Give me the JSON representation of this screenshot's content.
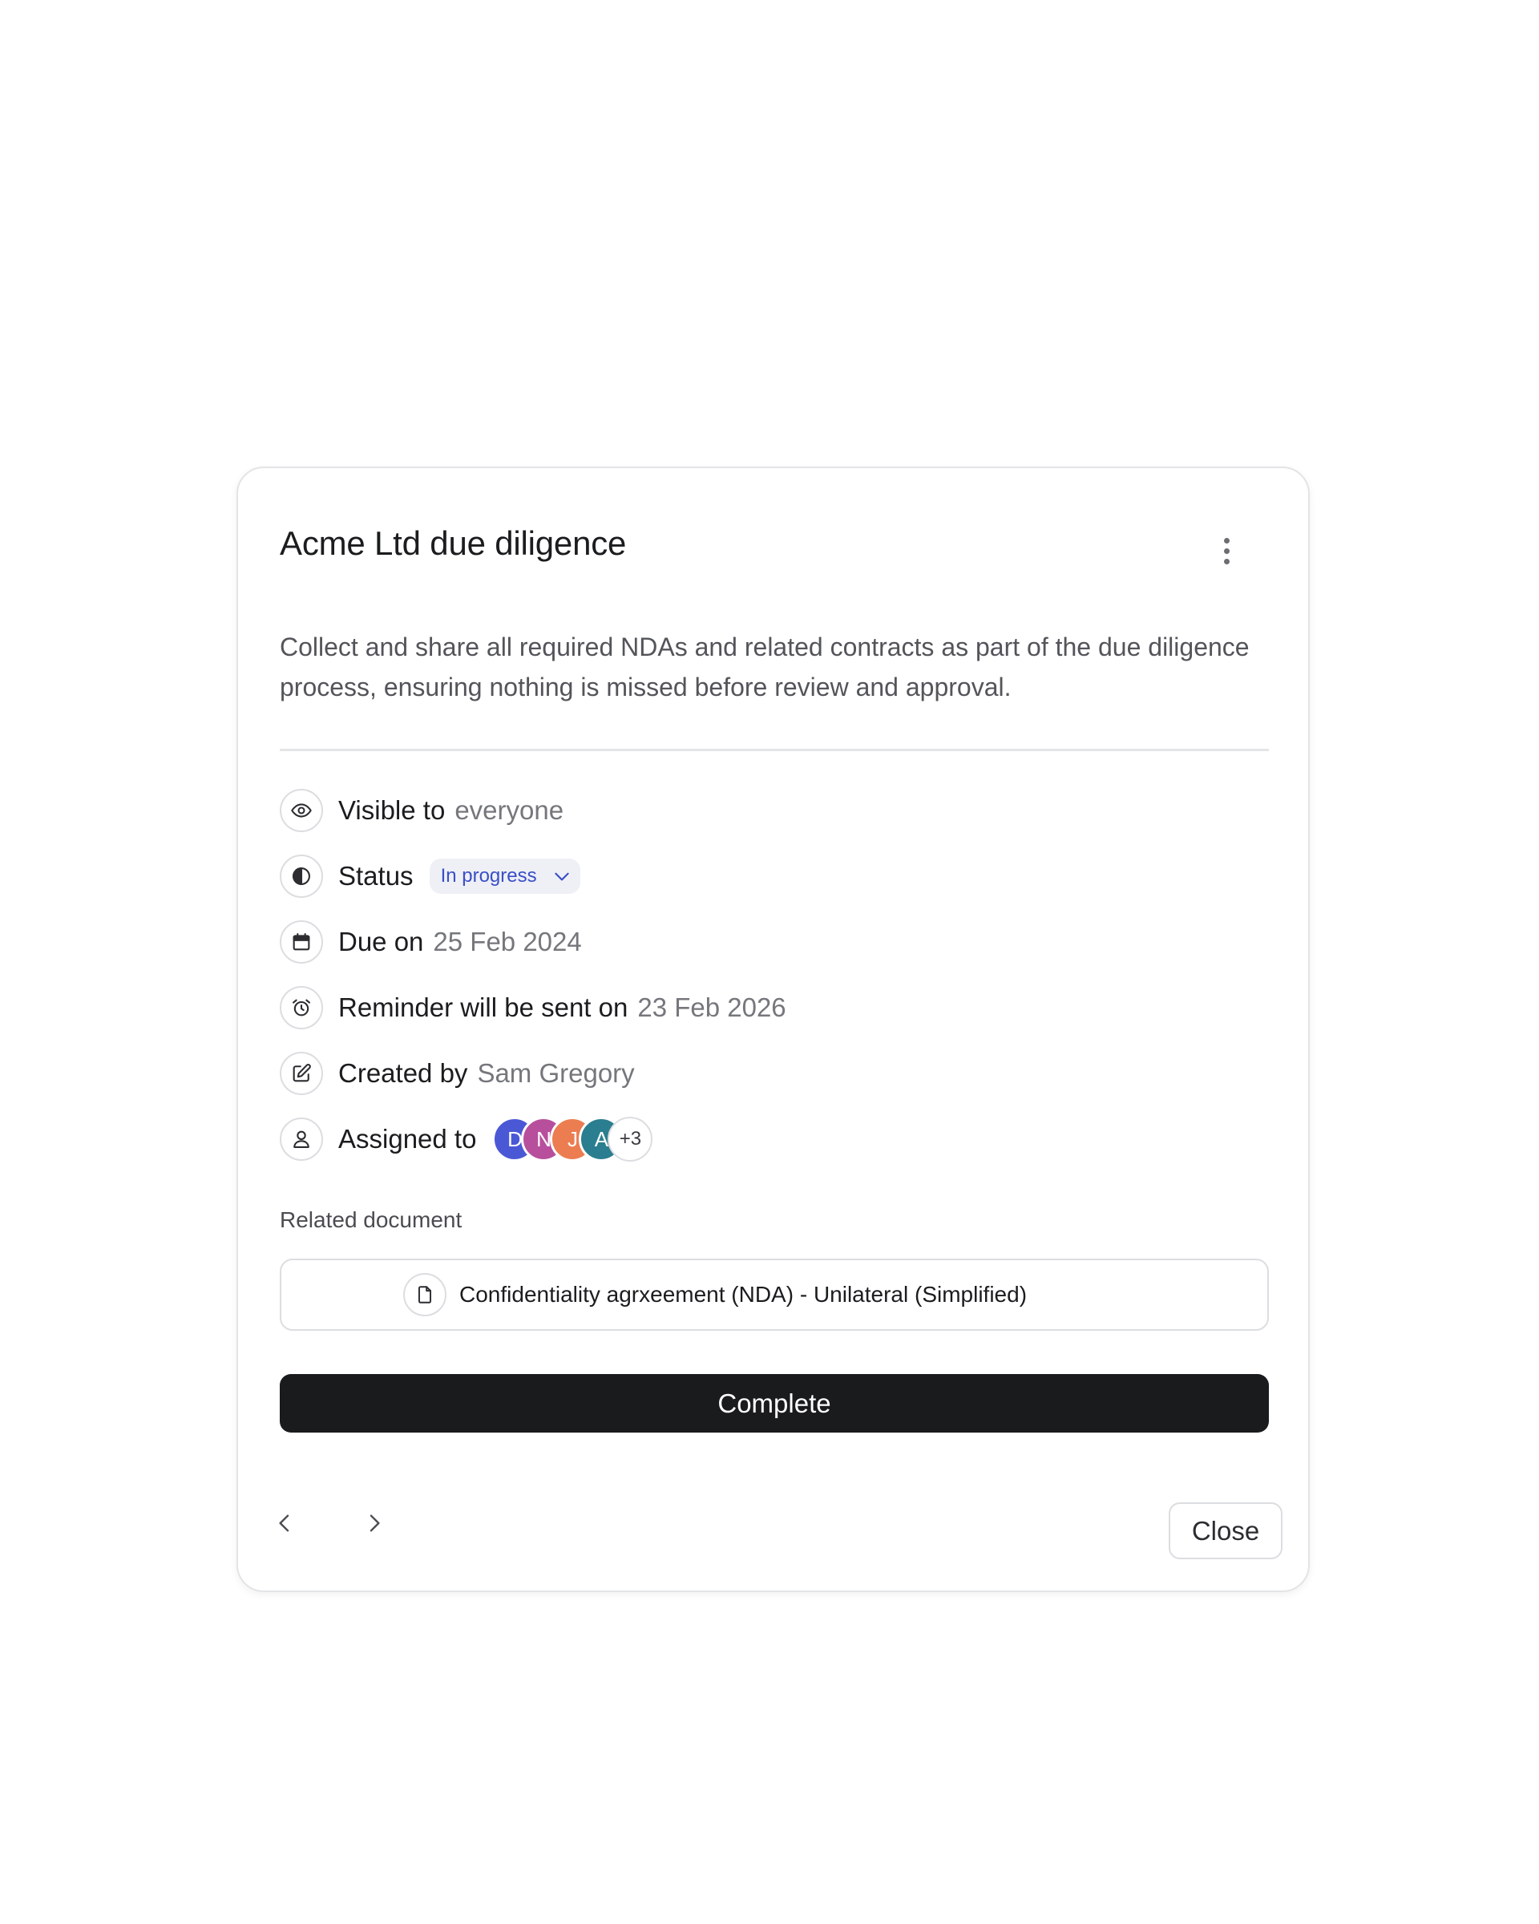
{
  "card": {
    "title": "Acme Ltd due diligence",
    "menu_icon": "more-vertical-icon",
    "description": "Collect and share all required NDAs and related contracts as part of the due diligence process, ensuring nothing is missed before review and approval."
  },
  "meta": {
    "visibility": {
      "icon": "eye-icon",
      "label": "Visible to",
      "value": "everyone"
    },
    "status": {
      "icon": "half-circle-icon",
      "label": "Status",
      "value": "In progress",
      "accent": "#3a4fc7"
    },
    "due": {
      "icon": "calendar-icon",
      "label": "Due on",
      "value": "25 Feb 2024"
    },
    "reminder": {
      "icon": "alarm-clock-icon",
      "label": "Reminder will be sent on",
      "value": "23 Feb 2026"
    },
    "created": {
      "icon": "edit-icon",
      "label": "Created by",
      "value": "Sam Gregory"
    },
    "assigned": {
      "icon": "user-icon",
      "label": "Assigned to",
      "avatars": [
        {
          "initial": "D",
          "color": "#4b58d6"
        },
        {
          "initial": "N",
          "color": "#b84f9c"
        },
        {
          "initial": "J",
          "color": "#ec7d50"
        },
        {
          "initial": "A",
          "color": "#2a7e8f"
        }
      ],
      "more": "+3"
    }
  },
  "related": {
    "heading": "Related document",
    "document_icon": "file-icon",
    "document_name": "Confidentiality agrxeement (NDA) - Unilateral (Simplified)"
  },
  "actions": {
    "complete_label": "Complete",
    "close_label": "Close",
    "prev_icon": "chevron-left-icon",
    "next_icon": "chevron-right-icon"
  },
  "colors": {
    "primary_button": "#1a1b1d",
    "muted_text": "#75777c",
    "border": "#dcdde0"
  }
}
